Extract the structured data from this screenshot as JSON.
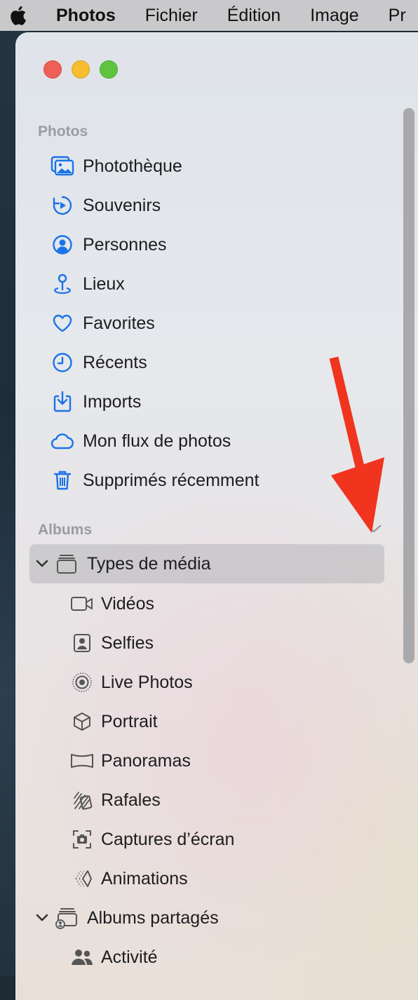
{
  "menubar": {
    "apple_icon": "apple-logo-icon",
    "app_name": "Photos",
    "items": [
      "Fichier",
      "Édition",
      "Image",
      "Pr"
    ]
  },
  "sidebar": {
    "photos_header": "Photos",
    "photos_items": [
      {
        "label": "Photothèque",
        "icon": "photo-library-icon"
      },
      {
        "label": "Souvenirs",
        "icon": "memories-icon"
      },
      {
        "label": "Personnes",
        "icon": "person-circle-icon"
      },
      {
        "label": "Lieux",
        "icon": "map-pin-icon"
      },
      {
        "label": "Favorites",
        "icon": "heart-icon"
      },
      {
        "label": "Récents",
        "icon": "clock-icon"
      },
      {
        "label": "Imports",
        "icon": "import-tray-icon"
      },
      {
        "label": "Mon flux de photos",
        "icon": "cloud-icon"
      },
      {
        "label": "Supprimés récemment",
        "icon": "trash-icon"
      }
    ],
    "albums_header": "Albums",
    "media_types": {
      "label": "Types de média",
      "icon": "stack-icon"
    },
    "media_items": [
      {
        "label": "Vidéos",
        "icon": "video-camera-icon"
      },
      {
        "label": "Selfies",
        "icon": "selfie-icon"
      },
      {
        "label": "Live Photos",
        "icon": "live-photo-icon"
      },
      {
        "label": "Portrait",
        "icon": "cube-icon"
      },
      {
        "label": "Panoramas",
        "icon": "panorama-icon"
      },
      {
        "label": "Rafales",
        "icon": "burst-icon"
      },
      {
        "label": "Captures d’écran",
        "icon": "screenshot-icon"
      },
      {
        "label": "Animations",
        "icon": "animation-icon"
      }
    ],
    "shared_albums": {
      "label": "Albums partagés",
      "icon": "shared-album-icon"
    },
    "shared_items": [
      {
        "label": "Activité",
        "icon": "people-icon"
      }
    ]
  },
  "colors": {
    "accent": "#1a73e8",
    "annotation_arrow": "#f0341e",
    "close": "#ee5f57",
    "minimize": "#f5bd2f",
    "maximize": "#5ec43f"
  }
}
